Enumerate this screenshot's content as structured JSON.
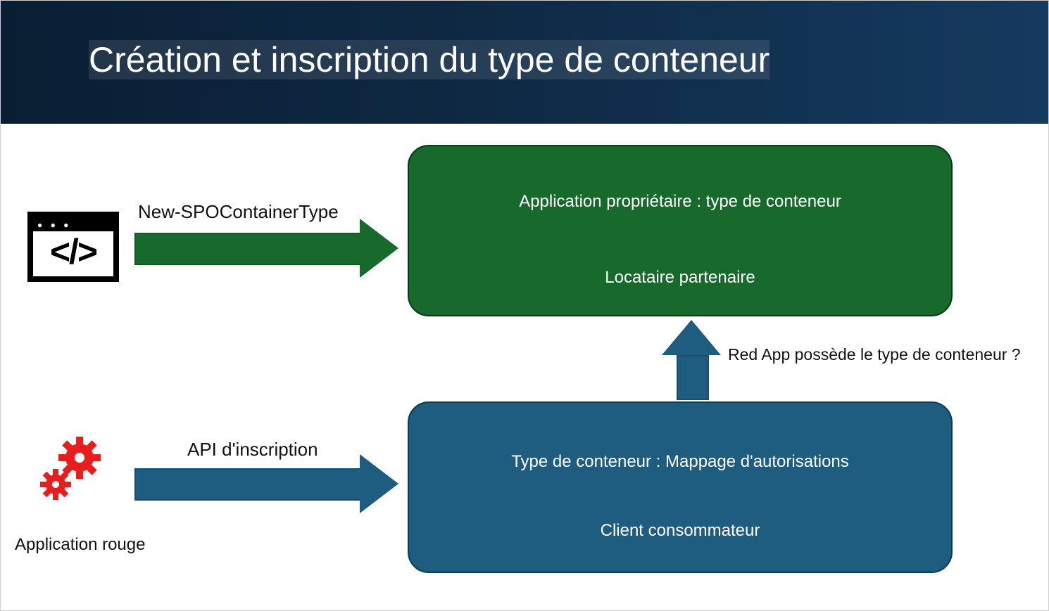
{
  "header": {
    "title": "Création et inscription du type de conteneur"
  },
  "arrows": {
    "top_label": "New-SPOContainerType",
    "bottom_label": "API d'inscription",
    "question_label": "Red App possède le type de conteneur ?"
  },
  "boxes": {
    "green": {
      "line1": "Application propriétaire : type de conteneur",
      "line2": "Locataire partenaire"
    },
    "blue": {
      "line1": "Type de conteneur : Mappage d'autorisations",
      "line2": "Client consommateur"
    }
  },
  "icons": {
    "code_label": "",
    "gears_label": "Application rouge"
  },
  "colors": {
    "green": "#17692c",
    "blue": "#1e5c80",
    "red": "#e61e1e"
  }
}
